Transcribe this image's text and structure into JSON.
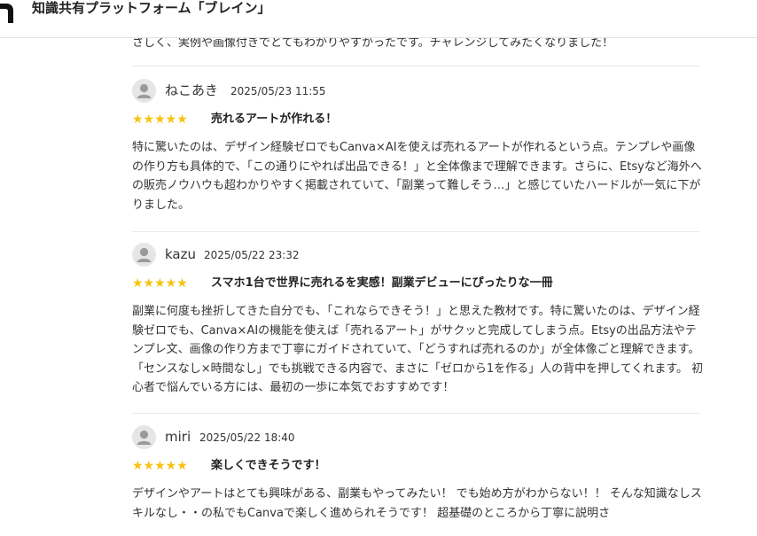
{
  "header": {
    "site_title": "知識共有プラットフォーム「ブレイン」",
    "logo_icon": "brain-logo-icon"
  },
  "previous_review_tail": "さしく、実例や画像付きでとてもわかりやすかったです。チャレンジしてみたくなりました！",
  "theme": {
    "star_color": "#f6c30e",
    "avatar_bg": "#e6e6e6",
    "avatar_fg": "#9a9a9a"
  },
  "reviews": [
    {
      "name": "ねこあき",
      "date": "2025/05/23 11:55",
      "stars": "★★★★★",
      "rating": 5,
      "title": "売れるアートが作れる！",
      "body": "特に驚いたのは、デザイン経験ゼロでもCanva×AIを使えば売れるアートが作れるという点。テンプレや画像の作り方も具体的で、「この通りにやれば出品できる！」と全体像まで理解できます。さらに、Etsyなど海外への販売ノウハウも超わかりやすく掲載されていて、「副業って難しそう…」と感じていたハードルが一気に下がりました。"
    },
    {
      "name": "kazu",
      "date": "2025/05/22 23:32",
      "stars": "★★★★★",
      "rating": 5,
      "title": "スマホ1台で世界に売れるを実感！副業デビューにぴったりな一冊",
      "body": "副業に何度も挫折してきた自分でも、「これならできそう！」と思えた教材です。特に驚いたのは、デザイン経験ゼロでも、Canva×AIの機能を使えば「売れるアート」がサクッと完成してしまう点。Etsyの出品方法やテンプレ文、画像の作り方まで丁寧にガイドされていて、「どうすれば売れるのか」が全体像ごと理解できます。 「センスなし×時間なし」でも挑戦できる内容で、まさに「ゼロから1を作る」人の背中を押してくれます。 初心者で悩んでいる方には、最初の一歩に本気でおすすめです！"
    },
    {
      "name": "miri",
      "date": "2025/05/22 18:40",
      "stars": "★★★★★",
      "rating": 5,
      "title": "楽しくできそうです！",
      "body": "デザインやアートはとても興味がある、副業もやってみたい！ でも始め方がわからない！！ そんな知識なしスキルなし・・の私でもCanvaで楽しく進められそうです！ 超基礎のところから丁寧に説明さ"
    }
  ]
}
